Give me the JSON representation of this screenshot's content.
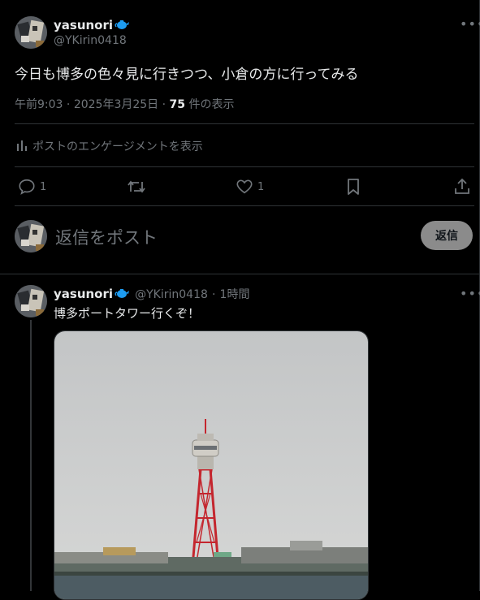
{
  "main_tweet": {
    "author_name": "yasunori",
    "author_handle": "@YKirin0418",
    "text": "今日も博多の色々見に行きつつ、小倉の方に行ってみる",
    "time": "午前9:03",
    "date": "2025年3月25日",
    "views_count": "75",
    "views_label": "件の表示",
    "engagement_label": "ポストのエンゲージメントを表示",
    "reply_count": "1",
    "retweet_count": "",
    "like_count": "1"
  },
  "reply_box": {
    "placeholder": "返信をポスト",
    "button_label": "返信"
  },
  "reply_tweet": {
    "author_name": "yasunori",
    "author_handle": "@YKirin0418",
    "time_ago": "1時間",
    "text": "博多ポートタワー行くぞ！"
  },
  "icons": [
    "more-icon",
    "reply-icon",
    "retweet-icon",
    "like-icon",
    "bookmark-icon",
    "share-icon",
    "analytics-icon",
    "verified-teapot-icon"
  ],
  "colors": {
    "background": "#000000",
    "text": "#e7e9ea",
    "secondary": "#71767b",
    "divider": "#2f3336",
    "badge": "#1d9bf0",
    "reply_button": "#8b8b8b"
  }
}
